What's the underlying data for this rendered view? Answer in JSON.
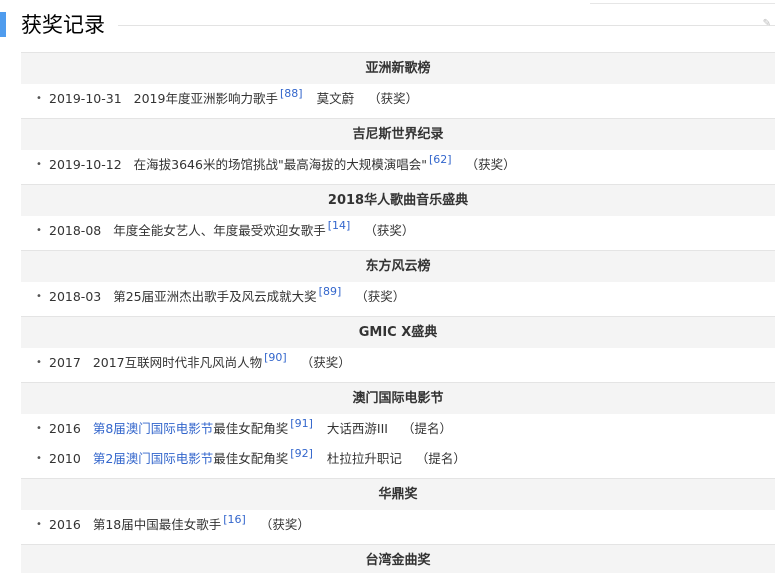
{
  "section": {
    "title": "获奖记录"
  },
  "groups": [
    {
      "name": "亚洲新歌榜",
      "items": [
        {
          "date": "2019-10-31",
          "link": "",
          "award": "2019年度亚洲影响力歌手",
          "ref": "[88]",
          "work": "莫文蔚",
          "result": "（获奖）"
        }
      ]
    },
    {
      "name": "吉尼斯世界纪录",
      "items": [
        {
          "date": "2019-10-12",
          "link": "",
          "award": "在海拔3646米的场馆挑战\"最高海拔的大规模演唱会\"",
          "ref": "[62]",
          "work": "",
          "result": "（获奖）"
        }
      ]
    },
    {
      "name": "2018华人歌曲音乐盛典",
      "items": [
        {
          "date": "2018-08",
          "link": "",
          "award": "年度全能女艺人、年度最受欢迎女歌手",
          "ref": "[14]",
          "work": "",
          "result": "（获奖）"
        }
      ]
    },
    {
      "name": "东方风云榜",
      "items": [
        {
          "date": "2018-03",
          "link": "",
          "award": "第25届亚洲杰出歌手及风云成就大奖",
          "ref": "[89]",
          "work": "",
          "result": "（获奖）"
        }
      ]
    },
    {
      "name": "GMIC X盛典",
      "items": [
        {
          "date": "2017",
          "link": "",
          "award": "2017互联网时代非凡风尚人物",
          "ref": "[90]",
          "work": "",
          "result": "（获奖）"
        }
      ]
    },
    {
      "name": "澳门国际电影节",
      "items": [
        {
          "date": "2016",
          "link": "第8届澳门国际电影节",
          "award": "最佳女配角奖",
          "ref": "[91]",
          "work": "大话西游III",
          "result": "（提名）"
        },
        {
          "date": "2010",
          "link": "第2届澳门国际电影节",
          "award": "最佳女配角奖",
          "ref": "[92]",
          "work": "杜拉拉升职记",
          "result": "（提名）"
        }
      ]
    },
    {
      "name": "华鼎奖",
      "items": [
        {
          "date": "2016",
          "link": "",
          "award": "第18届中国最佳女歌手",
          "ref": "[16]",
          "work": "",
          "result": "（获奖）"
        }
      ]
    },
    {
      "name": "台湾金曲奖",
      "items": []
    }
  ]
}
